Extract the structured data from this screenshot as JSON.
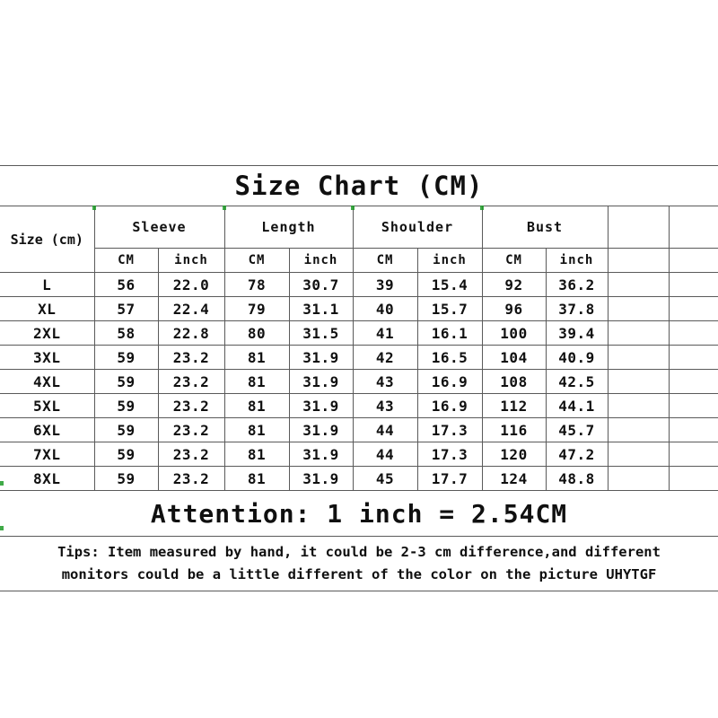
{
  "chart_data": {
    "type": "table",
    "title": "Size Chart (CM)",
    "row_header_label": "Size (cm)",
    "groups": [
      "Sleeve",
      "Length",
      "Shoulder",
      "Bust"
    ],
    "units": [
      "CM",
      "inch"
    ],
    "columns": [
      "Size (cm)",
      "Sleeve CM",
      "Sleeve inch",
      "Length CM",
      "Length inch",
      "Shoulder CM",
      "Shoulder inch",
      "Bust CM",
      "Bust inch"
    ],
    "categories": [
      "L",
      "XL",
      "2XL",
      "3XL",
      "4XL",
      "5XL",
      "6XL",
      "7XL",
      "8XL"
    ],
    "series": [
      {
        "name": "Sleeve CM",
        "values": [
          56,
          57,
          58,
          59,
          59,
          59,
          59,
          59,
          59
        ]
      },
      {
        "name": "Sleeve inch",
        "values": [
          22.0,
          22.4,
          22.8,
          23.2,
          23.2,
          23.2,
          23.2,
          23.2,
          23.2
        ]
      },
      {
        "name": "Length CM",
        "values": [
          78,
          79,
          80,
          81,
          81,
          81,
          81,
          81,
          81
        ]
      },
      {
        "name": "Length inch",
        "values": [
          30.7,
          31.1,
          31.5,
          31.9,
          31.9,
          31.9,
          31.9,
          31.9,
          31.9
        ]
      },
      {
        "name": "Shoulder CM",
        "values": [
          39,
          40,
          41,
          42,
          43,
          43,
          44,
          44,
          45
        ]
      },
      {
        "name": "Shoulder inch",
        "values": [
          15.4,
          15.7,
          16.1,
          16.5,
          16.9,
          16.9,
          17.3,
          17.3,
          17.7
        ]
      },
      {
        "name": "Bust CM",
        "values": [
          92,
          96,
          100,
          104,
          108,
          112,
          116,
          120,
          124
        ]
      },
      {
        "name": "Bust inch",
        "values": [
          36.2,
          37.8,
          39.4,
          40.9,
          42.5,
          44.1,
          45.7,
          47.2,
          48.8
        ]
      }
    ],
    "empty_columns": 2,
    "rows": [
      [
        "L",
        "56",
        "22.0",
        "78",
        "30.7",
        "39",
        "15.4",
        "92",
        "36.2",
        "",
        ""
      ],
      [
        "XL",
        "57",
        "22.4",
        "79",
        "31.1",
        "40",
        "15.7",
        "96",
        "37.8",
        "",
        ""
      ],
      [
        "2XL",
        "58",
        "22.8",
        "80",
        "31.5",
        "41",
        "16.1",
        "100",
        "39.4",
        "",
        ""
      ],
      [
        "3XL",
        "59",
        "23.2",
        "81",
        "31.9",
        "42",
        "16.5",
        "104",
        "40.9",
        "",
        ""
      ],
      [
        "4XL",
        "59",
        "23.2",
        "81",
        "31.9",
        "43",
        "16.9",
        "108",
        "42.5",
        "",
        ""
      ],
      [
        "5XL",
        "59",
        "23.2",
        "81",
        "31.9",
        "43",
        "16.9",
        "112",
        "44.1",
        "",
        ""
      ],
      [
        "6XL",
        "59",
        "23.2",
        "81",
        "31.9",
        "44",
        "17.3",
        "116",
        "45.7",
        "",
        ""
      ],
      [
        "7XL",
        "59",
        "23.2",
        "81",
        "31.9",
        "44",
        "17.3",
        "120",
        "47.2",
        "",
        ""
      ],
      [
        "8XL",
        "59",
        "23.2",
        "81",
        "31.9",
        "45",
        "17.7",
        "124",
        "48.8",
        "",
        ""
      ]
    ],
    "attention": "Attention: 1 inch = 2.54CM",
    "tips_line_1": "Tips: Item measured by hand, it could be 2-3 cm difference,and different",
    "tips_line_2": "monitors could be a little different of the color on the picture UHYTGF",
    "colors": {
      "accent_red": "#f20d0d",
      "text": "#101010",
      "grid": "#5a5a5a",
      "background": "#ffffff"
    }
  }
}
